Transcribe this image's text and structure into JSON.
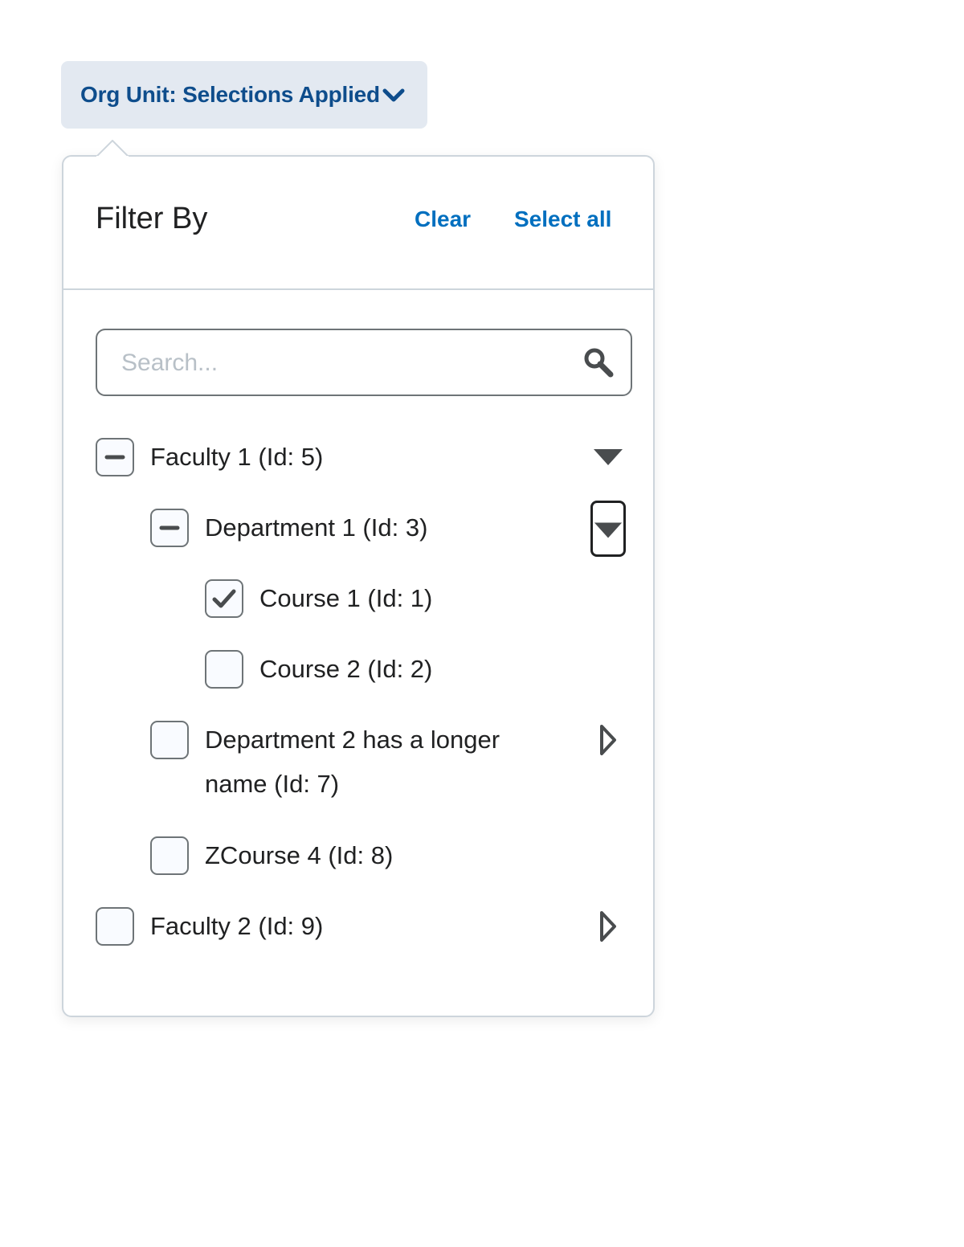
{
  "filter_button": {
    "label": "Org Unit: Selections Applied",
    "icon": "chevron-down-icon",
    "expanded": true
  },
  "panel": {
    "title": "Filter By",
    "clear_label": "Clear",
    "select_all_label": "Select all"
  },
  "search": {
    "placeholder": "Search...",
    "value": "",
    "icon": "search-icon"
  },
  "tree": [
    {
      "label": "Faculty 1 (Id: 5)",
      "state": "indeterminate",
      "toggle": "expanded"
    },
    {
      "label": "Department 1 (Id: 3)",
      "state": "indeterminate",
      "toggle": "expanded-focused"
    },
    {
      "label": "Course 1 (Id: 1)",
      "state": "checked",
      "toggle": "none"
    },
    {
      "label": "Course 2 (Id: 2)",
      "state": "unchecked",
      "toggle": "none"
    },
    {
      "label": "Department 2 has a longer name (Id: 7)",
      "state": "unchecked",
      "toggle": "collapsed"
    },
    {
      "label": "ZCourse 4 (Id: 8)",
      "state": "unchecked",
      "toggle": "none"
    },
    {
      "label": "Faculty 2 (Id: 9)",
      "state": "unchecked",
      "toggle": "collapsed"
    }
  ],
  "colors": {
    "link": "#006fbf",
    "button_text": "#0e4d8c",
    "button_bg": "#e3e9f1",
    "border": "#cdd5dc",
    "icon": "#494c4e"
  }
}
